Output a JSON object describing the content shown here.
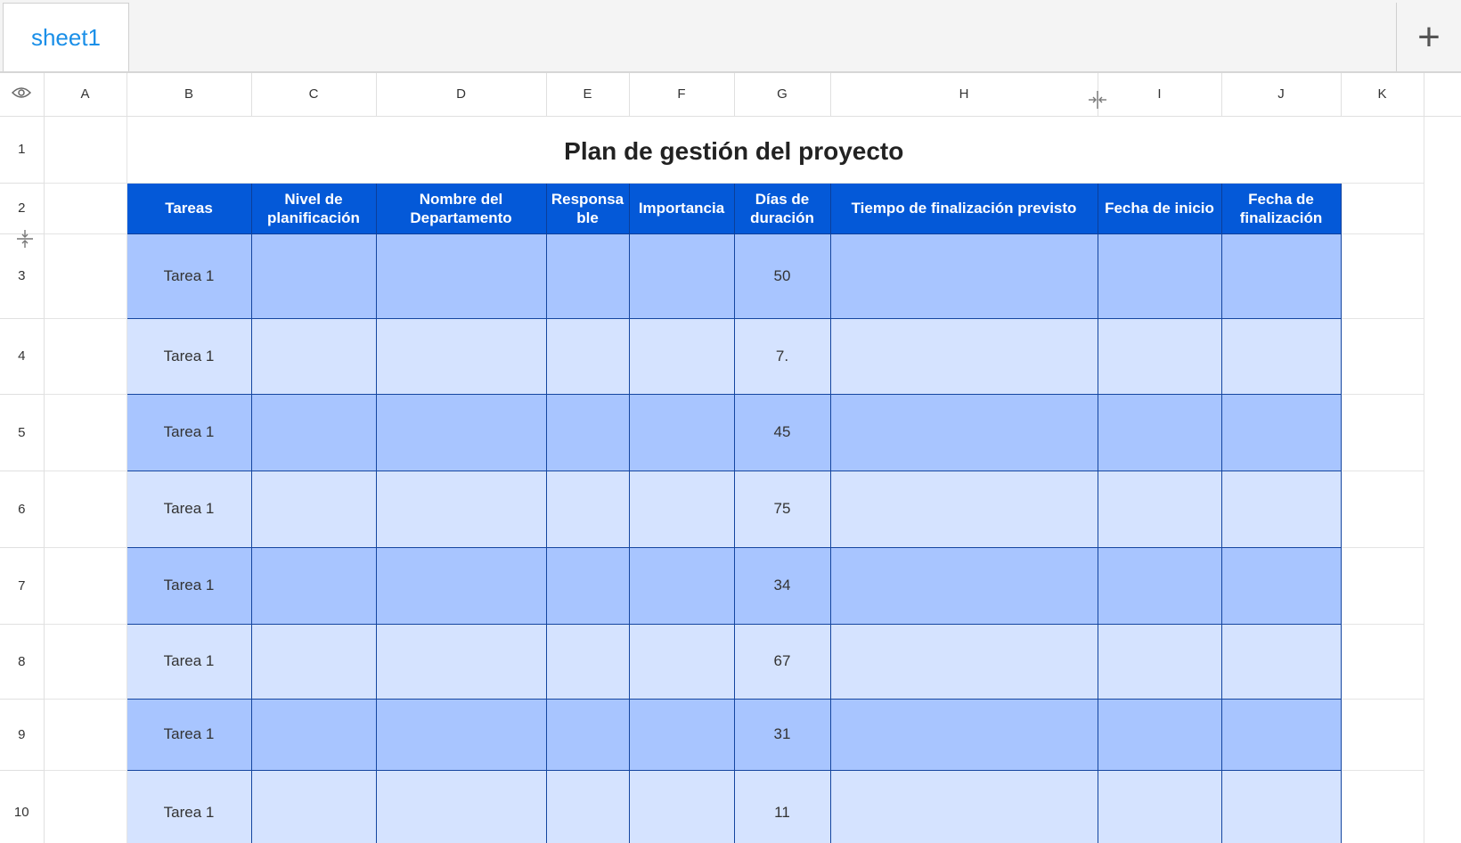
{
  "tabs": {
    "active_label": "sheet1",
    "add_icon": "+"
  },
  "columns": [
    "A",
    "B",
    "C",
    "D",
    "E",
    "F",
    "G",
    "H",
    "I",
    "J",
    "K"
  ],
  "rows": [
    "1",
    "2",
    "3",
    "4",
    "5",
    "6",
    "7",
    "8",
    "9",
    "10"
  ],
  "title": "Plan de gestión del proyecto",
  "table_headers": [
    [
      "Tareas"
    ],
    [
      "Nivel de",
      "planificación"
    ],
    [
      "Nombre del",
      "Departamento"
    ],
    [
      "Responsa",
      "ble"
    ],
    [
      "Importancia"
    ],
    [
      "Días de",
      "duración"
    ],
    [
      "Tiempo de finalización previsto"
    ],
    [
      "Fecha de inicio"
    ],
    [
      "Fecha de",
      "finalización"
    ]
  ],
  "table_rows": [
    {
      "task": "Tarea 1",
      "duration": "50"
    },
    {
      "task": "Tarea 1",
      "duration": "7."
    },
    {
      "task": "Tarea 1",
      "duration": "45"
    },
    {
      "task": "Tarea 1",
      "duration": "75"
    },
    {
      "task": "Tarea 1",
      "duration": "34"
    },
    {
      "task": "Tarea 1",
      "duration": "67"
    },
    {
      "task": "Tarea 1",
      "duration": "31"
    },
    {
      "task": "Tarea 1",
      "duration": "11"
    }
  ],
  "colors": {
    "header_blue": "#0459d8",
    "row_dark": "#a8c5ff",
    "row_light": "#d5e3ff",
    "tab_text": "#1a8fe8"
  }
}
